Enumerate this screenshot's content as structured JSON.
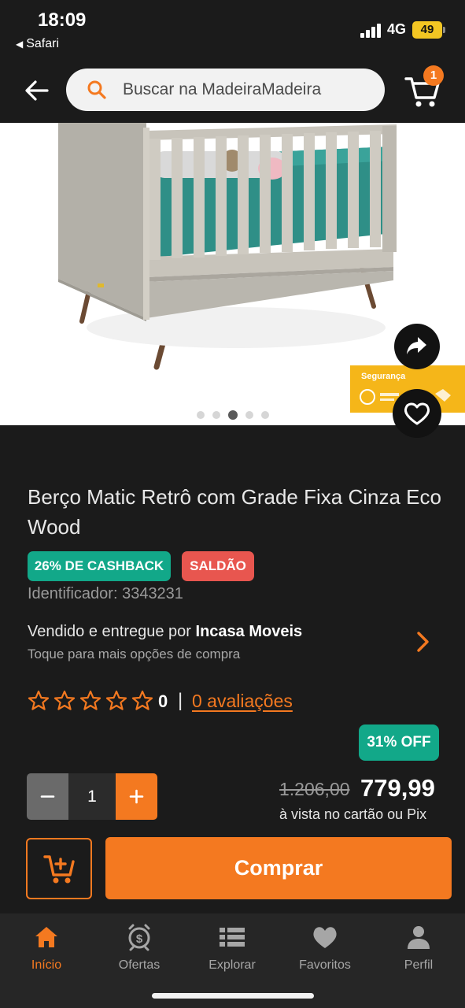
{
  "status_bar": {
    "time": "18:09",
    "back_app": "Safari",
    "network": "4G",
    "battery": "49"
  },
  "header": {
    "search_placeholder": "Buscar na MadeiraMadeira",
    "cart_count": "1"
  },
  "product": {
    "image_dots": 5,
    "active_dot": 2,
    "seal_text": "Segurança",
    "title": "Berço Matic Retrô com Grade Fixa Cinza Eco Wood",
    "badges": {
      "cashback": "26% DE CASHBACK",
      "sale": "SALDÃO"
    },
    "identifier": "Identificador: 3343231",
    "seller": {
      "prefix": "Vendido e entregue por",
      "name": "Incasa Moveis",
      "subtitle": "Toque para mais opções de compra"
    },
    "rating": {
      "value": "0",
      "stars": 5,
      "separator": "|",
      "reviews_link": "0 avaliações"
    },
    "discount_badge": "31% OFF",
    "quantity": "1",
    "old_price": "1.206,00",
    "price": "779,99",
    "price_note": "à vista no cartão ou Pix",
    "buy_label": "Comprar"
  },
  "bottom_nav": [
    {
      "label": "Início",
      "icon": "home-icon",
      "active": true
    },
    {
      "label": "Ofertas",
      "icon": "alarm-dollar-icon",
      "active": false
    },
    {
      "label": "Explorar",
      "icon": "list-icon",
      "active": false
    },
    {
      "label": "Favoritos",
      "icon": "heart-icon",
      "active": false
    },
    {
      "label": "Perfil",
      "icon": "user-icon",
      "active": false
    }
  ],
  "colors": {
    "accent": "#f47920",
    "green": "#12a889",
    "red": "#e8564f",
    "background": "#1b1b1b"
  }
}
